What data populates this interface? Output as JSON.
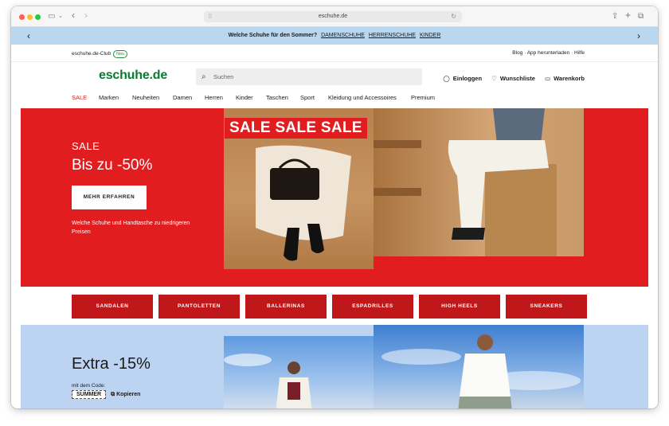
{
  "browser": {
    "url": "eschuhe.de"
  },
  "promo_bar": {
    "text": "Welche Schuhe für den Sommer?",
    "links": [
      "DAMENSCHUHE",
      "HERRENSCHUHE",
      "KINDER"
    ]
  },
  "utility": {
    "club": "eschuhe.de-Club",
    "badge": "Neu",
    "links": "Blog · App herunterladen · Hilfe"
  },
  "header": {
    "logo": "eschuhe.de",
    "search_placeholder": "Suchen",
    "login": "Einloggen",
    "wishlist": "Wunschliste",
    "cart": "Warenkorb"
  },
  "nav": [
    "SALE",
    "Marken",
    "Neuheiten",
    "Damen",
    "Herren",
    "Kinder",
    "Taschen",
    "Sport",
    "Kleidung und Accessoires",
    "Premium"
  ],
  "hero": {
    "kicker": "SALE",
    "headline": "Bis zu -50%",
    "cta": "MEHR ERFAHREN",
    "subtext": "Welche Schuhe und Handtasche zu niedrigeren Preisen",
    "overlay": "SALE SALE SALE"
  },
  "categories": [
    "SANDALEN",
    "PANTOLETTEN",
    "BALLERINAS",
    "ESPADRILLES",
    "HIGH HEELS",
    "SNEAKERS"
  ],
  "promo2": {
    "headline": "Extra -15%",
    "code_label": "mit dem Code:",
    "code": "SUMMER",
    "copy": "Kopieren"
  },
  "colors": {
    "brand_green": "#0b7a33",
    "sale_red": "#e21d1f",
    "category_red": "#c0171b",
    "promo_blue": "#b9d7ef"
  }
}
